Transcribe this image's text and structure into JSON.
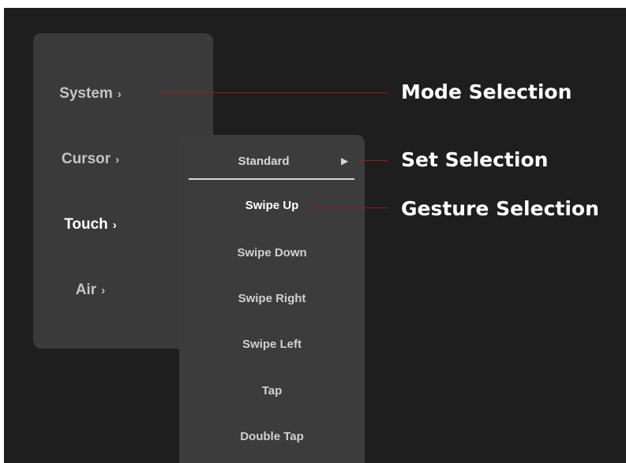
{
  "mode_menu": {
    "items": [
      {
        "label": "System",
        "chevron": "›"
      },
      {
        "label": "Cursor",
        "chevron": "›"
      },
      {
        "label": "Touch",
        "chevron": "›",
        "active": true
      },
      {
        "label": "Air",
        "chevron": "›"
      }
    ]
  },
  "gesture_menu": {
    "set": {
      "label": "Standard",
      "arrow": "▶"
    },
    "items": [
      {
        "label": "Swipe Up",
        "active": true
      },
      {
        "label": "Swipe Down"
      },
      {
        "label": "Swipe Right"
      },
      {
        "label": "Swipe Left"
      },
      {
        "label": "Tap"
      },
      {
        "label": "Double Tap"
      }
    ]
  },
  "callouts": {
    "mode": "Mode Selection",
    "set": "Set Selection",
    "gesture": "Gesture Selection"
  },
  "colors": {
    "background": "#1e1e1e",
    "panel": "#3a3a3a",
    "leader_line": "#8a1f2c"
  },
  "icons": {
    "chevron": "chevron-right-icon",
    "arrow": "play-arrow-icon"
  }
}
